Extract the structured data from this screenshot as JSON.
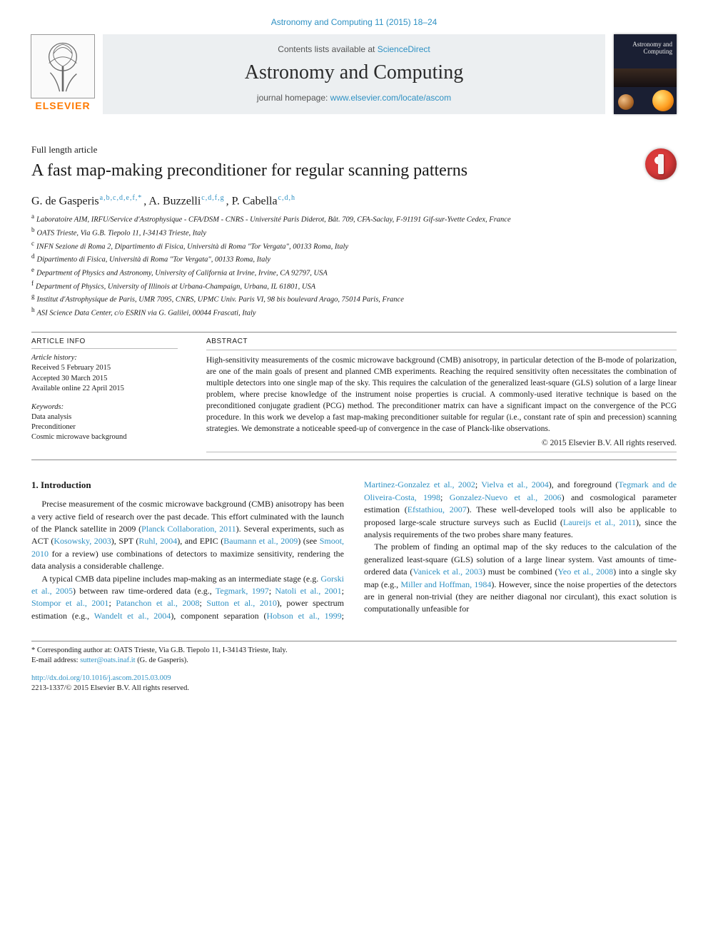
{
  "running_head": "Astronomy and Computing 11 (2015) 18–24",
  "masthead": {
    "contents_prefix": "Contents lists available at ",
    "contents_link": "ScienceDirect",
    "journal": "Astronomy and Computing",
    "homepage_prefix": "journal homepage: ",
    "homepage_link": "www.elsevier.com/locate/ascom",
    "elsevier_word": "ELSEVIER",
    "cover_title_line1": "Astronomy and",
    "cover_title_line2": "Computing"
  },
  "paper": {
    "type": "Full length article",
    "title": "A fast map-making preconditioner for regular scanning patterns",
    "authors": [
      {
        "name": "G. de Gasperis",
        "super": "a,b,c,d,e,f,*"
      },
      {
        "name": "A. Buzzelli",
        "super": "c,d,f,g"
      },
      {
        "name": "P. Cabella",
        "super": "c,d,h"
      }
    ],
    "affiliations": [
      {
        "label": "a",
        "text": "Laboratoire AIM, IRFU/Service d'Astrophysique - CFA/DSM - CNRS - Université Paris Diderot, Bât. 709, CFA-Saclay, F-91191 Gif-sur-Yvette Cedex, France"
      },
      {
        "label": "b",
        "text": "OATS Trieste, Via G.B. Tiepolo 11, I-34143 Trieste, Italy"
      },
      {
        "label": "c",
        "text": "INFN Sezione di Roma 2, Dipartimento di Fisica, Università di Roma \"Tor Vergata\", 00133 Roma, Italy"
      },
      {
        "label": "d",
        "text": "Dipartimento di Fisica, Università di Roma \"Tor Vergata\", 00133 Roma, Italy"
      },
      {
        "label": "e",
        "text": "Department of Physics and Astronomy, University of California at Irvine, Irvine, CA 92797, USA"
      },
      {
        "label": "f",
        "text": "Department of Physics, University of Illinois at Urbana-Champaign, Urbana, IL 61801, USA"
      },
      {
        "label": "g",
        "text": "Institut d'Astrophysique de Paris, UMR 7095, CNRS, UPMC Univ. Paris VI, 98 bis boulevard Arago, 75014 Paris, France"
      },
      {
        "label": "h",
        "text": "ASI Science Data Center, c/o ESRIN via G. Galilei, 00044 Frascati, Italy"
      }
    ]
  },
  "history": {
    "heading": "ARTICLE INFO",
    "lines": [
      "Article history:",
      "Received 5 February 2015",
      "Accepted 30 March 2015",
      "Available online 22 April 2015"
    ],
    "keywords_heading": "Keywords:",
    "keywords": [
      "Data analysis",
      "Preconditioner",
      "Cosmic microwave background"
    ]
  },
  "abstract": {
    "heading": "ABSTRACT",
    "text": "High-sensitivity measurements of the cosmic microwave background (CMB) anisotropy, in particular detection of the B-mode of polarization, are one of the main goals of present and planned CMB experiments. Reaching the required sensitivity often necessitates the combination of multiple detectors into one single map of the sky. This requires the calculation of the generalized least-square (GLS) solution of a large linear problem, where precise knowledge of the instrument noise properties is crucial. A commonly-used iterative technique is based on the preconditioned conjugate gradient (PCG) method. The preconditioner matrix can have a significant impact on the convergence of the PCG procedure. In this work we develop a fast map-making preconditioner suitable for regular (i.e., constant rate of spin and precession) scanning strategies. We demonstrate a noticeable speed-up of convergence in the case of Planck-like observations.",
    "copyright": "© 2015 Elsevier B.V. All rights reserved."
  },
  "body": {
    "section_heading": "1. Introduction",
    "para1_a": "Precise measurement of the cosmic microwave background (CMB) anisotropy has been a very active field of research over the past decade. This effort culminated with the launch of the Planck satellite in 2009 (",
    "ref_planck": "Planck Collaboration, 2011",
    "para1_b": "). Several experiments, such as ACT (",
    "ref_kosowsky": "Kosowsky, 2003",
    "para1_c": "), SPT (",
    "ref_ruhl": "Ruhl, 2004",
    "para1_d": "), and EPIC (",
    "ref_baumann": "Baumann et al., 2009",
    "para1_e": ") (see ",
    "ref_smoot": "Smoot, 2010",
    "para1_f": " for a review) use combinations of detectors to maximize sensitivity, rendering the data analysis a considerable challenge.",
    "para2_a": "A typical CMB data pipeline includes map-making as an intermediate stage (e.g. ",
    "ref_gorski": "Gorski et al., 2005",
    "para2_b": ") between raw time-ordered data (e.g., ",
    "ref_tegmark97": "Tegmark, 1997",
    "sep1": "; ",
    "ref_natoli": "Natoli et al., 2001",
    "sep2": "; ",
    "ref_stompor": "Stompor et al., 2001",
    "sep3": "; ",
    "ref_patanchon": "Patanchon et al., 2008",
    "sep4": "; ",
    "ref_sutton": "Sutton et al., 2010",
    "para2_c": "), power spectrum estimation (e.g., ",
    "ref_wandelt": "Wandelt et al., 2004",
    "para2_d": "), component separation (",
    "ref_hobson": "Hobson et al., 1999",
    "sep5": "; ",
    "ref_mg": "Martinez-Gonzalez et al., 2002",
    "sep6": "; ",
    "ref_vielva": "Vielva et al., 2004",
    "para2_e": "), and foreground (",
    "ref_toc": "Tegmark and de Oliveira-Costa, 1998",
    "sep7": "; ",
    "ref_gn": "Gonzalez-Nuevo et al., 2006",
    "para2_f": ") and cosmological parameter estimation (",
    "ref_efs": "Efstathiou, 2007",
    "para2_g": "). These well-developed tools will also be applicable to proposed large-scale structure surveys such as Euclid (",
    "ref_laur": "Laureijs et al., 2011",
    "para2_h": "), since the analysis requirements of the two probes share many features.",
    "para3_a": "The problem of finding an optimal map of the sky reduces to the calculation of the generalized least-square (GLS) solution of a large linear system. Vast amounts of time-ordered data (",
    "ref_vanicek": "Vanicek et al., 2003",
    "para3_b": ") must be combined (",
    "ref_yeo": "Yeo et al., 2008",
    "para3_c": ") into a single sky map (e.g., ",
    "ref_mh": "Miller and Hoffman, 1984",
    "para3_d": "). However, since the noise properties of the detectors are in general non-trivial (they are neither diagonal nor circulant), this exact solution is computationally unfeasible for"
  },
  "footer": {
    "corr_label": "* Corresponding author at: OATS Trieste, Via G.B. Tiepolo 11, I-34143 Trieste, Italy.",
    "email_label": "E-mail address: ",
    "email": "sutter@oats.inaf.it",
    "email_tail": " (G. de Gasperis).",
    "doi": "http://dx.doi.org/10.1016/j.ascom.2015.03.009",
    "issn_line": "2213-1337/© 2015 Elsevier B.V. All rights reserved."
  }
}
